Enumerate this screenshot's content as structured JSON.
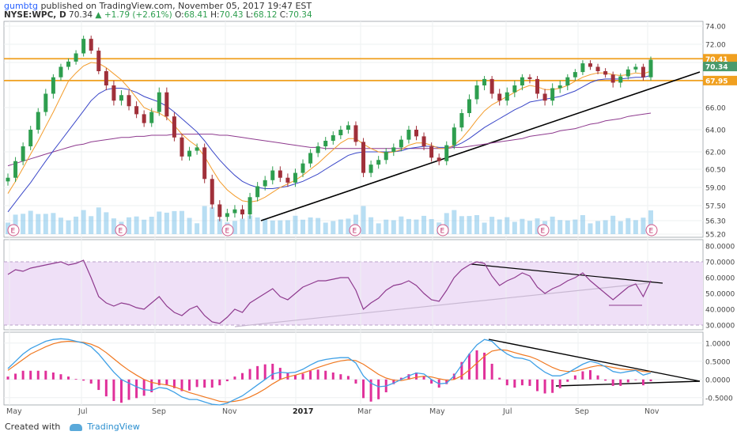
{
  "header": {
    "author": "gumbtg",
    "published_text": "published on TradingView.com, November 05, 2017 19:47 EST",
    "symbol": "NYSE:WPC, D",
    "last": "70.34",
    "arrow": "▲",
    "change": "+1.79 (+2.61%)",
    "o_label": "O:",
    "o_value": "68.41",
    "h_label": "H:",
    "h_value": "70.43",
    "l_label": "L:",
    "l_value": "68.12",
    "c_label": "C:",
    "c_value": "70.34"
  },
  "footer": {
    "created_with": "Created with",
    "brand": "TradingView"
  },
  "colors": {
    "up": "#2e9e4f",
    "down": "#a0303a",
    "ma_short": "#f39c2b",
    "ma_mid": "#3a47c8",
    "ma_long": "#8e3a8e",
    "level": "#f0a020",
    "rsi": "#8e3a8e",
    "macd": "#3ea0e6",
    "signal": "#f07820",
    "hist_pos": "#e0309a",
    "volume": "#7ec3ea"
  },
  "chart_data": [
    {
      "type": "line",
      "panel": "price",
      "x_ticks": [
        "May",
        "Jul",
        "Sep",
        "Nov",
        "2017",
        "Mar",
        "May",
        "Jul",
        "Sep",
        "Nov"
      ],
      "y_ticks": [
        "74.00",
        "72.00",
        "70.00",
        "68.00",
        "66.00",
        "64.00",
        "62.00",
        "60.50",
        "59.00",
        "57.50",
        "56.30",
        "55.20"
      ],
      "ylim": [
        55.2,
        74.0
      ],
      "horizontal_levels": [
        {
          "value": 70.41,
          "label": "70.41"
        },
        {
          "value": 67.95,
          "label": "67.95"
        }
      ],
      "last_price_label": "70.34",
      "earnings_marker": "E",
      "earnings_count": 6,
      "close_series": [
        59.8,
        61.2,
        62.5,
        64.0,
        65.6,
        67.0,
        68.3,
        69.5,
        70.1,
        71.0,
        72.6,
        71.3,
        69.0,
        67.6,
        66.5,
        66.9,
        66.1,
        65.4,
        64.6,
        65.6,
        67.1,
        65.2,
        63.3,
        61.6,
        62.1,
        62.4,
        59.7,
        57.6,
        56.6,
        56.9,
        57.2,
        56.8,
        58.2,
        59.1,
        59.6,
        60.4,
        59.8,
        59.4,
        60.2,
        61.0,
        61.9,
        62.5,
        63.0,
        63.5,
        64.0,
        64.4,
        62.9,
        60.2,
        60.9,
        61.3,
        62.0,
        62.4,
        63.1,
        64.0,
        63.4,
        62.5,
        61.5,
        61.2,
        62.6,
        64.2,
        65.5,
        66.6,
        67.6,
        68.1,
        67.0,
        66.5,
        67.1,
        67.6,
        68.3,
        68.1,
        67.0,
        66.5,
        67.4,
        67.6,
        68.3,
        68.9,
        69.9,
        69.5,
        69.0,
        68.6,
        67.8,
        68.4,
        69.2,
        69.5,
        68.3,
        70.3
      ],
      "ma_short_series": [
        58.5,
        59.5,
        60.6,
        61.8,
        63.0,
        64.3,
        65.6,
        66.8,
        67.9,
        68.8,
        69.6,
        70.0,
        69.9,
        69.4,
        68.7,
        68.0,
        67.4,
        66.7,
        66.0,
        65.7,
        65.5,
        65.1,
        64.4,
        63.6,
        63.0,
        62.5,
        61.6,
        60.5,
        59.5,
        58.8,
        58.3,
        57.9,
        57.8,
        57.9,
        58.2,
        58.6,
        59.0,
        59.3,
        59.6,
        60.0,
        60.5,
        61.0,
        61.6,
        62.2,
        62.8,
        63.2,
        63.2,
        62.7,
        62.3,
        62.0,
        61.9,
        62.0,
        62.2,
        62.6,
        62.8,
        62.8,
        62.6,
        62.3,
        62.3,
        62.6,
        63.2,
        64.0,
        64.9,
        65.7,
        66.2,
        66.5,
        66.8,
        67.1,
        67.4,
        67.6,
        67.5,
        67.3,
        67.3,
        67.4,
        67.6,
        67.9,
        68.3,
        68.6,
        68.8,
        68.8,
        68.6,
        68.5,
        68.6,
        68.8,
        68.7,
        69.0
      ],
      "ma_mid_series": [
        57.0,
        57.8,
        58.6,
        59.4,
        60.3,
        61.2,
        62.1,
        63.0,
        63.9,
        64.8,
        65.7,
        66.5,
        67.0,
        67.3,
        67.4,
        67.4,
        67.3,
        67.1,
        66.8,
        66.6,
        66.4,
        66.1,
        65.6,
        65.0,
        64.4,
        63.8,
        63.0,
        62.1,
        61.3,
        60.6,
        60.0,
        59.5,
        59.2,
        59.0,
        58.9,
        58.9,
        59.0,
        59.1,
        59.3,
        59.5,
        59.8,
        60.1,
        60.5,
        60.9,
        61.3,
        61.7,
        61.9,
        62.0,
        62.0,
        62.0,
        62.0,
        62.0,
        62.1,
        62.3,
        62.4,
        62.5,
        62.5,
        62.4,
        62.4,
        62.5,
        62.8,
        63.2,
        63.7,
        64.2,
        64.6,
        65.0,
        65.4,
        65.8,
        66.1,
        66.4,
        66.5,
        66.6,
        66.7,
        66.8,
        67.0,
        67.2,
        67.5,
        67.8,
        68.0,
        68.1,
        68.1,
        68.1,
        68.2,
        68.3,
        68.3,
        68.5
      ],
      "ma_long_series": [
        60.8,
        61.0,
        61.2,
        61.4,
        61.6,
        61.8,
        62.0,
        62.2,
        62.4,
        62.6,
        62.7,
        62.9,
        63.0,
        63.1,
        63.2,
        63.3,
        63.3,
        63.4,
        63.4,
        63.5,
        63.5,
        63.5,
        63.6,
        63.6,
        63.6,
        63.6,
        63.6,
        63.6,
        63.5,
        63.5,
        63.4,
        63.3,
        63.2,
        63.1,
        63.0,
        62.9,
        62.8,
        62.7,
        62.6,
        62.5,
        62.4,
        62.4,
        62.3,
        62.3,
        62.3,
        62.3,
        62.3,
        62.3,
        62.3,
        62.3,
        62.3,
        62.3,
        62.3,
        62.3,
        62.3,
        62.3,
        62.3,
        62.3,
        62.3,
        62.4,
        62.4,
        62.5,
        62.6,
        62.7,
        62.8,
        62.9,
        63.0,
        63.1,
        63.2,
        63.4,
        63.5,
        63.6,
        63.7,
        63.9,
        64.0,
        64.1,
        64.3,
        64.5,
        64.6,
        64.8,
        64.9,
        65.0,
        65.2,
        65.3,
        65.4,
        65.5
      ]
    },
    {
      "type": "line",
      "panel": "rsi",
      "y_ticks": [
        "80.0000",
        "70.0000",
        "60.0000",
        "50.0000",
        "40.0000",
        "30.0000"
      ],
      "ylim": [
        27,
        84
      ],
      "band": [
        30,
        70
      ],
      "series": [
        62,
        65,
        64,
        66,
        67,
        68,
        69,
        70,
        68,
        69,
        71,
        60,
        48,
        44,
        42,
        44,
        43,
        41,
        40,
        44,
        48,
        42,
        38,
        36,
        40,
        42,
        36,
        32,
        31,
        35,
        40,
        38,
        44,
        47,
        50,
        53,
        48,
        46,
        50,
        54,
        56,
        58,
        58,
        59,
        60,
        60,
        52,
        40,
        44,
        47,
        52,
        55,
        56,
        58,
        55,
        50,
        46,
        45,
        52,
        60,
        65,
        68,
        70,
        69,
        61,
        55,
        58,
        60,
        63,
        61,
        54,
        50,
        53,
        55,
        58,
        60,
        63,
        58,
        54,
        50,
        46,
        50,
        54,
        56,
        48,
        58
      ]
    },
    {
      "type": "line",
      "panel": "macd",
      "y_ticks": [
        "1.0000",
        "0.5000",
        "0.0000",
        "-0.5000"
      ],
      "ylim": [
        -0.7,
        1.3
      ],
      "macd_series": [
        0.3,
        0.5,
        0.7,
        0.85,
        0.95,
        1.05,
        1.1,
        1.12,
        1.1,
        1.05,
        1.0,
        0.9,
        0.7,
        0.45,
        0.2,
        0.0,
        -0.1,
        -0.2,
        -0.28,
        -0.3,
        -0.22,
        -0.25,
        -0.35,
        -0.48,
        -0.55,
        -0.55,
        -0.62,
        -0.68,
        -0.7,
        -0.65,
        -0.55,
        -0.45,
        -0.3,
        -0.15,
        0.0,
        0.15,
        0.2,
        0.18,
        0.2,
        0.28,
        0.4,
        0.5,
        0.55,
        0.58,
        0.6,
        0.6,
        0.45,
        0.1,
        -0.1,
        -0.2,
        -0.18,
        -0.1,
        0.0,
        0.1,
        0.18,
        0.15,
        0.0,
        -0.12,
        -0.1,
        0.1,
        0.4,
        0.7,
        0.95,
        1.1,
        1.05,
        0.85,
        0.7,
        0.6,
        0.58,
        0.52,
        0.35,
        0.2,
        0.1,
        0.1,
        0.18,
        0.3,
        0.42,
        0.5,
        0.45,
        0.35,
        0.22,
        0.18,
        0.22,
        0.25,
        0.12,
        0.18
      ],
      "signal_series": [
        0.25,
        0.4,
        0.55,
        0.7,
        0.8,
        0.9,
        0.98,
        1.03,
        1.05,
        1.04,
        1.02,
        0.97,
        0.88,
        0.74,
        0.57,
        0.4,
        0.25,
        0.12,
        0.0,
        -0.08,
        -0.12,
        -0.15,
        -0.2,
        -0.28,
        -0.36,
        -0.42,
        -0.48,
        -0.54,
        -0.6,
        -0.62,
        -0.6,
        -0.56,
        -0.48,
        -0.38,
        -0.26,
        -0.12,
        0.0,
        0.07,
        0.12,
        0.18,
        0.25,
        0.33,
        0.4,
        0.46,
        0.51,
        0.54,
        0.52,
        0.42,
        0.28,
        0.14,
        0.04,
        -0.02,
        -0.03,
        0.01,
        0.06,
        0.09,
        0.07,
        0.02,
        -0.02,
        0.0,
        0.1,
        0.26,
        0.45,
        0.64,
        0.78,
        0.82,
        0.8,
        0.74,
        0.68,
        0.63,
        0.55,
        0.44,
        0.33,
        0.25,
        0.22,
        0.23,
        0.28,
        0.34,
        0.38,
        0.37,
        0.33,
        0.29,
        0.27,
        0.26,
        0.22,
        0.21
      ]
    }
  ]
}
